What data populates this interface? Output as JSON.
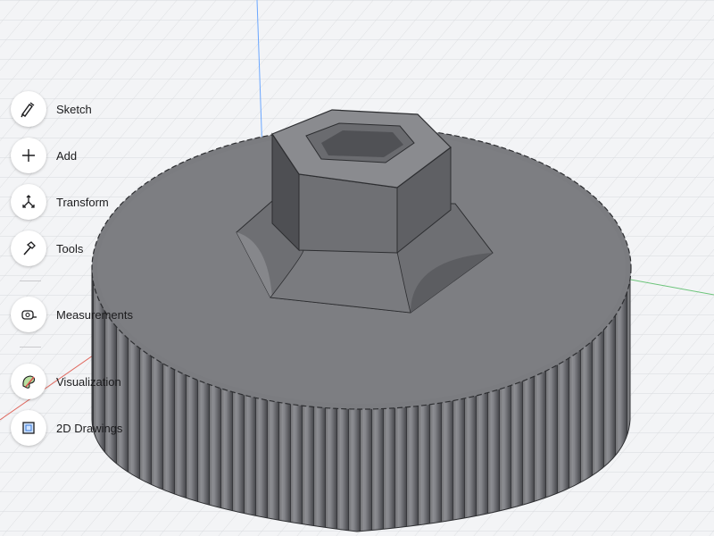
{
  "toolbar": {
    "items": [
      {
        "label": "Sketch",
        "icon": "sketch-pen-icon"
      },
      {
        "label": "Add",
        "icon": "plus-icon"
      },
      {
        "label": "Transform",
        "icon": "transform-arrows-icon"
      },
      {
        "label": "Tools",
        "icon": "hammer-icon"
      },
      {
        "label": "Measurements",
        "icon": "tape-measure-icon"
      },
      {
        "label": "Visualization",
        "icon": "palette-icon"
      },
      {
        "label": "2D Drawings",
        "icon": "blueprint-icon"
      }
    ]
  },
  "colors": {
    "grid_background": "#f3f4f6",
    "grid_line": "#d8dadd",
    "axis_y": "#6aa6ff",
    "axis_x": "#e0695f",
    "axis_z": "#6cc47a",
    "model": "#77787c",
    "accent": "#1c1c1e"
  }
}
